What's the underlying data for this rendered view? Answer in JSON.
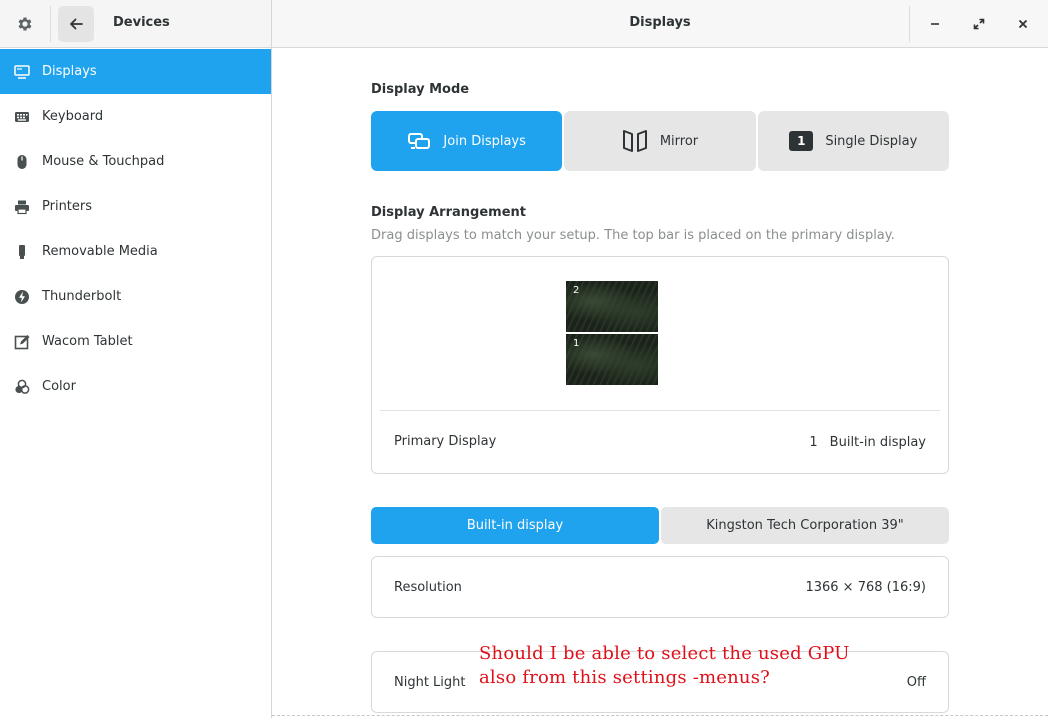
{
  "header": {
    "left_title": "Devices",
    "center_title": "Displays"
  },
  "sidebar": {
    "items": [
      {
        "label": "Displays",
        "icon": "display-icon",
        "active": true
      },
      {
        "label": "Keyboard",
        "icon": "keyboard-icon"
      },
      {
        "label": "Mouse & Touchpad",
        "icon": "mouse-icon"
      },
      {
        "label": "Printers",
        "icon": "printer-icon"
      },
      {
        "label": "Removable Media",
        "icon": "usb-drive-icon"
      },
      {
        "label": "Thunderbolt",
        "icon": "thunderbolt-icon"
      },
      {
        "label": "Wacom Tablet",
        "icon": "tablet-icon"
      },
      {
        "label": "Color",
        "icon": "color-icon"
      }
    ]
  },
  "display_mode": {
    "title": "Display Mode",
    "options": [
      {
        "label": "Join Displays",
        "icon": "join-displays-icon",
        "selected": true
      },
      {
        "label": "Mirror",
        "icon": "mirror-icon"
      },
      {
        "label": "Single Display",
        "icon": "single-display-icon",
        "badge": "1"
      }
    ]
  },
  "arrangement": {
    "title": "Display Arrangement",
    "subtitle": "Drag displays to match your setup. The top bar is placed on the primary display.",
    "monitors": [
      {
        "number": "2"
      },
      {
        "number": "1"
      }
    ],
    "primary_label": "Primary Display",
    "primary_number": "1",
    "primary_value": "Built-in display"
  },
  "display_tabs": [
    {
      "label": "Built-in display",
      "active": true
    },
    {
      "label": "Kingston Tech Corporation 39\""
    }
  ],
  "resolution": {
    "label": "Resolution",
    "value": "1366 × 768 (16:9)"
  },
  "night_light": {
    "label": "Night Light",
    "value": "Off"
  },
  "annotation": {
    "line1": "Should I be able to select the used GPU",
    "line2": "also from this settings -menus?"
  },
  "colors": {
    "accent": "#1fa3ee",
    "annotation": "#e0101a"
  }
}
